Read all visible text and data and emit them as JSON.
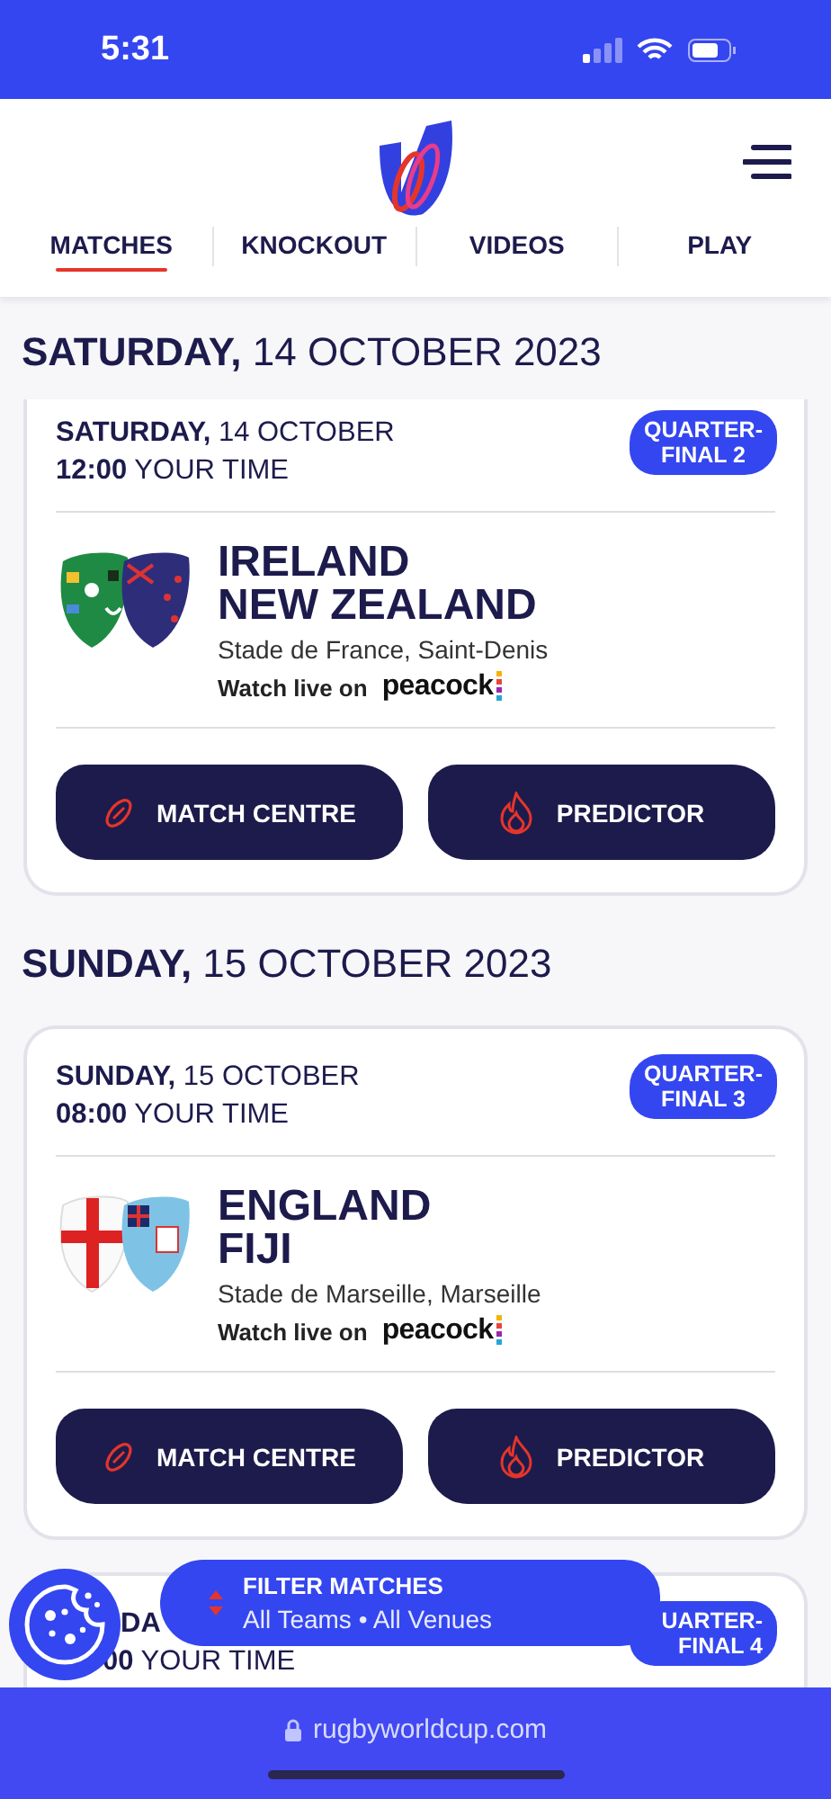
{
  "status_bar": {
    "time": "5:31"
  },
  "nav": {
    "tabs": [
      {
        "label": "MATCHES",
        "selected": true
      },
      {
        "label": "KNOCKOUT",
        "selected": false
      },
      {
        "label": "VIDEOS",
        "selected": false
      },
      {
        "label": "PLAY",
        "selected": false
      }
    ]
  },
  "sections": [
    {
      "day": "SATURDAY,",
      "date": "14 OCTOBER 2023",
      "cards": [
        {
          "cut_top": true,
          "day": "SATURDAY,",
          "date": "14 OCTOBER",
          "time": "12:00",
          "time_label": "YOUR TIME",
          "badge": [
            "QUARTER-",
            "FINAL 2"
          ],
          "flags": [
            {
              "kind": "ireland"
            },
            {
              "kind": "new_zealand"
            }
          ],
          "teams": [
            "IRELAND",
            "NEW ZEALAND"
          ],
          "venue": "Stade de France, Saint-Denis",
          "watch": "Watch live on",
          "broadcaster": "peacock",
          "buttons": [
            {
              "kind": "match_centre",
              "label": "MATCH CENTRE"
            },
            {
              "kind": "predictor",
              "label": "PREDICTOR"
            }
          ]
        }
      ]
    },
    {
      "day": "SUNDAY,",
      "date": "15 OCTOBER 2023",
      "cards": [
        {
          "day": "SUNDAY,",
          "date": "15 OCTOBER",
          "time": "08:00",
          "time_label": "YOUR TIME",
          "badge": [
            "QUARTER-",
            "FINAL 3"
          ],
          "flags": [
            {
              "kind": "england"
            },
            {
              "kind": "fiji"
            }
          ],
          "teams": [
            "ENGLAND",
            "FIJI"
          ],
          "venue": "Stade de Marseille, Marseille",
          "watch": "Watch live on",
          "broadcaster": "peacock",
          "buttons": [
            {
              "kind": "match_centre",
              "label": "MATCH CENTRE"
            },
            {
              "kind": "predictor",
              "label": "PREDICTOR"
            }
          ]
        },
        {
          "partial": true,
          "day": "DA",
          "time": "00",
          "time_label": "YOUR TIME",
          "badge": [
            "UARTER-",
            "FINAL 4"
          ]
        }
      ]
    }
  ],
  "filter": {
    "title": "FILTER MATCHES",
    "summary": "All Teams • All Venues"
  },
  "browser_bar": {
    "url": "rugbyworldcup.com"
  }
}
